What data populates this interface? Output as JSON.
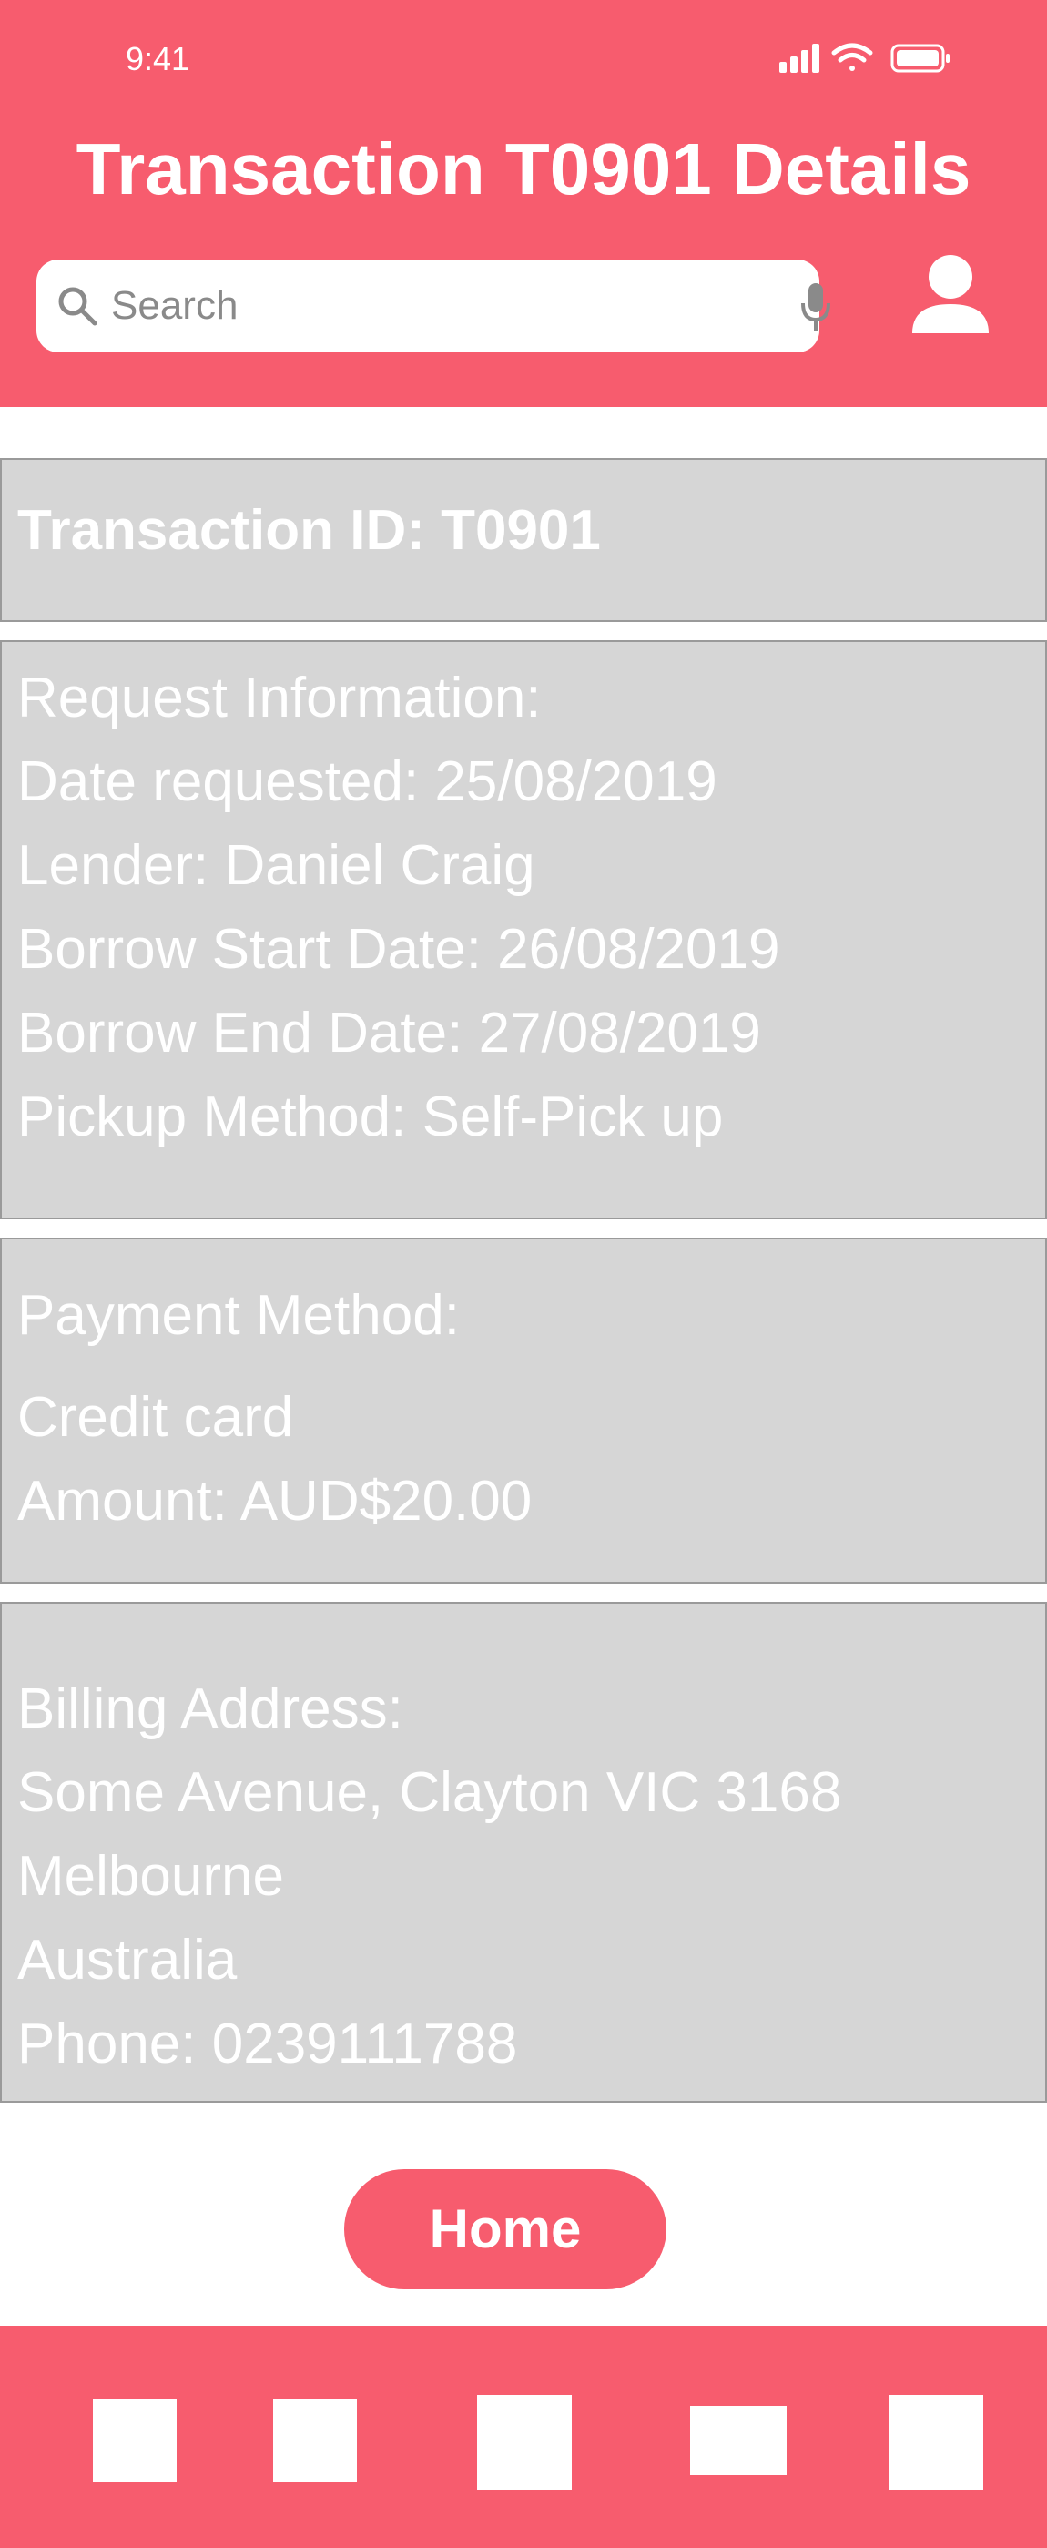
{
  "status_bar": {
    "time": "9:41"
  },
  "header": {
    "title": "Transaction T0901 Details"
  },
  "search": {
    "placeholder": "Search"
  },
  "transaction": {
    "id_line": "Transaction ID: T0901"
  },
  "request_info": {
    "heading": "Request Information:",
    "date_requested": "Date requested: 25/08/2019",
    "lender": "Lender: Daniel Craig",
    "borrow_start": "Borrow Start Date: 26/08/2019",
    "borrow_end": "Borrow End Date: 27/08/2019",
    "pickup_method": "Pickup Method: Self-Pick up"
  },
  "payment": {
    "heading": "Payment Method:",
    "method": "Credit card",
    "amount": "Amount: AUD$20.00"
  },
  "billing": {
    "heading": "Billing Address:",
    "street": "Some Avenue, Clayton VIC 3168",
    "city": "Melbourne",
    "country": "Australia",
    "phone": "Phone: 0239111788"
  },
  "actions": {
    "home_label": "Home"
  },
  "colors": {
    "accent": "#f75c6e",
    "card_bg": "#d6d6d6",
    "card_border": "#9a9a9a"
  },
  "tab_bar": {
    "icons": [
      "tab-1-icon",
      "tab-2-icon",
      "tab-3-icon",
      "tab-4-icon",
      "tab-5-icon"
    ]
  }
}
